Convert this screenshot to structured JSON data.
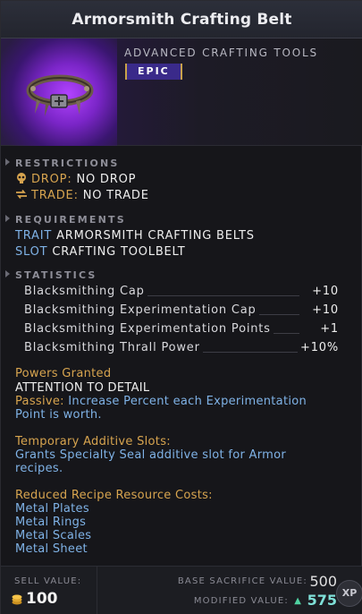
{
  "item": {
    "title": "Armorsmith Crafting Belt",
    "subtitle": "ADVANCED CRAFTING TOOLS",
    "rarity": "EPIC"
  },
  "restrictions": {
    "header": "RESTRICTIONS",
    "drop_label": "DROP:",
    "drop_value": "NO DROP",
    "trade_label": "TRADE:",
    "trade_value": "NO TRADE"
  },
  "requirements": {
    "header": "REQUIREMENTS",
    "trait_label": "TRAIT",
    "trait_value": "ARMORSMITH CRAFTING BELTS",
    "slot_label": "SLOT",
    "slot_value": "CRAFTING TOOLBELT"
  },
  "statistics": {
    "header": "STATISTICS",
    "items": [
      {
        "name": "Blacksmithing Cap",
        "value": "+10"
      },
      {
        "name": "Blacksmithing Experimentation Cap",
        "value": "+10"
      },
      {
        "name": "Blacksmithing Experimentation Points",
        "value": "+1"
      },
      {
        "name": "Blacksmithing Thrall Power",
        "value": "+10%"
      }
    ]
  },
  "powers": {
    "header": "Powers Granted",
    "name": "ATTENTION TO DETAIL",
    "passive_label": "Passive:",
    "passive_text_1": "Increase Percent each Experimentation",
    "passive_text_2": "Point is worth."
  },
  "additive_slots": {
    "header": "Temporary Additive Slots:",
    "line_1": "Grants Specialty Seal additive slot for Armor",
    "line_2": "recipes."
  },
  "reduced_costs": {
    "header": "Reduced Recipe Resource Costs:",
    "items": [
      "Metal Plates",
      "Metal Rings",
      "Metal Scales",
      "Metal Sheet"
    ]
  },
  "footer": {
    "sell_label": "SELL VALUE:",
    "sell_value": "100",
    "base_label": "BASE SACRIFICE VALUE:",
    "base_value": "500",
    "modified_label": "MODIFIED VALUE:",
    "modified_value": "575",
    "xp_badge": "XP"
  },
  "colors": {
    "rarity_bg": "#3a2a8a",
    "gold_text": "#d7a44f",
    "blue_text": "#7fb2e6",
    "modified_value": "#7fe0d8"
  },
  "icons": [
    "skull-icon",
    "trade-arrows-icon",
    "coin-stack-icon",
    "up-arrow-icon"
  ]
}
